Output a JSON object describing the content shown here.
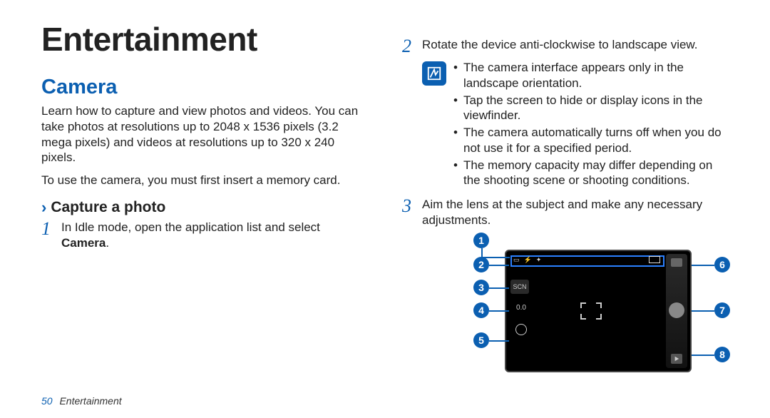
{
  "chapter": {
    "title": "Entertainment"
  },
  "section": {
    "title": "Camera"
  },
  "intro": {
    "p1": "Learn how to capture and view photos and videos. You can take photos at resolutions up to 2048 x 1536 pixels (3.2 mega pixels) and videos at resolutions up to 320 x 240 pixels.",
    "p2": "To use the camera, you must first insert a memory card."
  },
  "subheading": {
    "text": "Capture a photo"
  },
  "steps": {
    "s1_pre": "In Idle mode, open the application list and select ",
    "s1_bold": "Camera",
    "s1_post": ".",
    "s2": "Rotate the device anti-clockwise to landscape view.",
    "s3": "Aim the lens at the subject and make any necessary adjustments."
  },
  "notes": {
    "n1": "The camera interface appears only in the landscape orientation.",
    "n2": "Tap the screen to hide or display icons in the viewfinder.",
    "n3": "The camera automatically turns off when you do not use it for a specified period.",
    "n4": "The memory capacity may differ depending on the shooting scene or shooting conditions."
  },
  "viewfinder": {
    "scn_label": "SCN",
    "ev_label": "0.0",
    "callouts": [
      "1",
      "2",
      "3",
      "4",
      "5",
      "6",
      "7",
      "8"
    ]
  },
  "footer": {
    "page_number": "50",
    "label": "Entertainment"
  }
}
